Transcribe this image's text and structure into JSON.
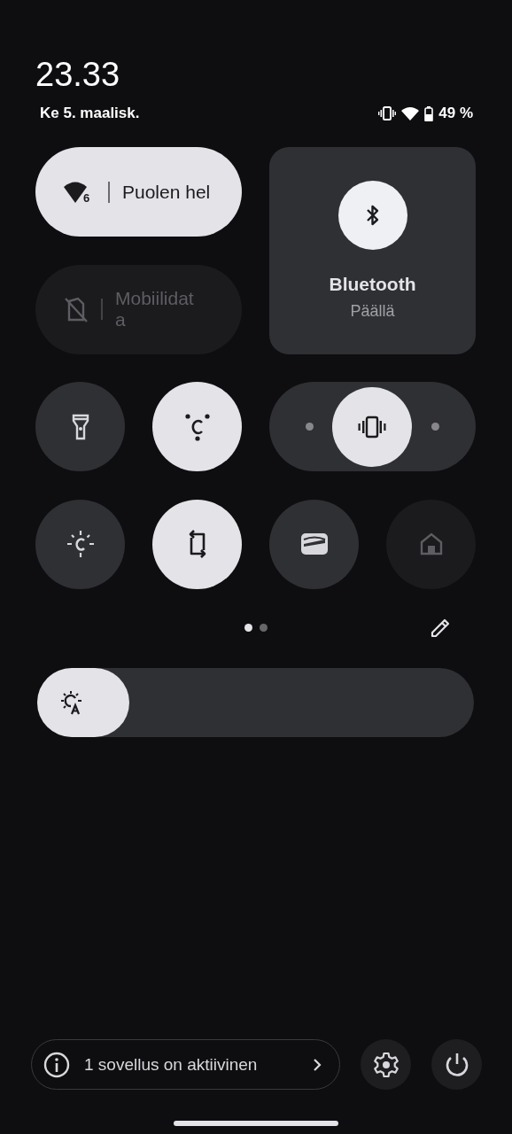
{
  "status": {
    "time": "23.33",
    "date": "Ke 5. maalisk.",
    "battery": "49 %"
  },
  "tiles": [
    {
      "kind": "wide",
      "label": "Puolen hel",
      "badge": "6",
      "on": true
    },
    {
      "kind": "wide",
      "label": "Mobiilidata",
      "disabled": true
    },
    {
      "kind": "large",
      "label": "Bluetooth",
      "sublabel": "Päällä",
      "on": true
    },
    {
      "kind": "round",
      "on": false,
      "disabled": false
    },
    {
      "kind": "round",
      "on": true,
      "disabled": false
    },
    {
      "kind": "ringer",
      "options": [
        {
          "selected": false
        },
        {
          "selected": true
        },
        {
          "selected": false
        }
      ]
    },
    {
      "kind": "round",
      "on": false,
      "disabled": false
    },
    {
      "kind": "round",
      "on": true,
      "disabled": false
    },
    {
      "kind": "round",
      "on": false,
      "disabled": false
    },
    {
      "kind": "round",
      "disabled": true
    }
  ],
  "pages": [
    {
      "selected": true
    },
    {
      "selected": false
    }
  ],
  "brightness": {
    "level": 0.21
  },
  "footer": {
    "active_apps": "1 sovellus on aktiivinen"
  }
}
